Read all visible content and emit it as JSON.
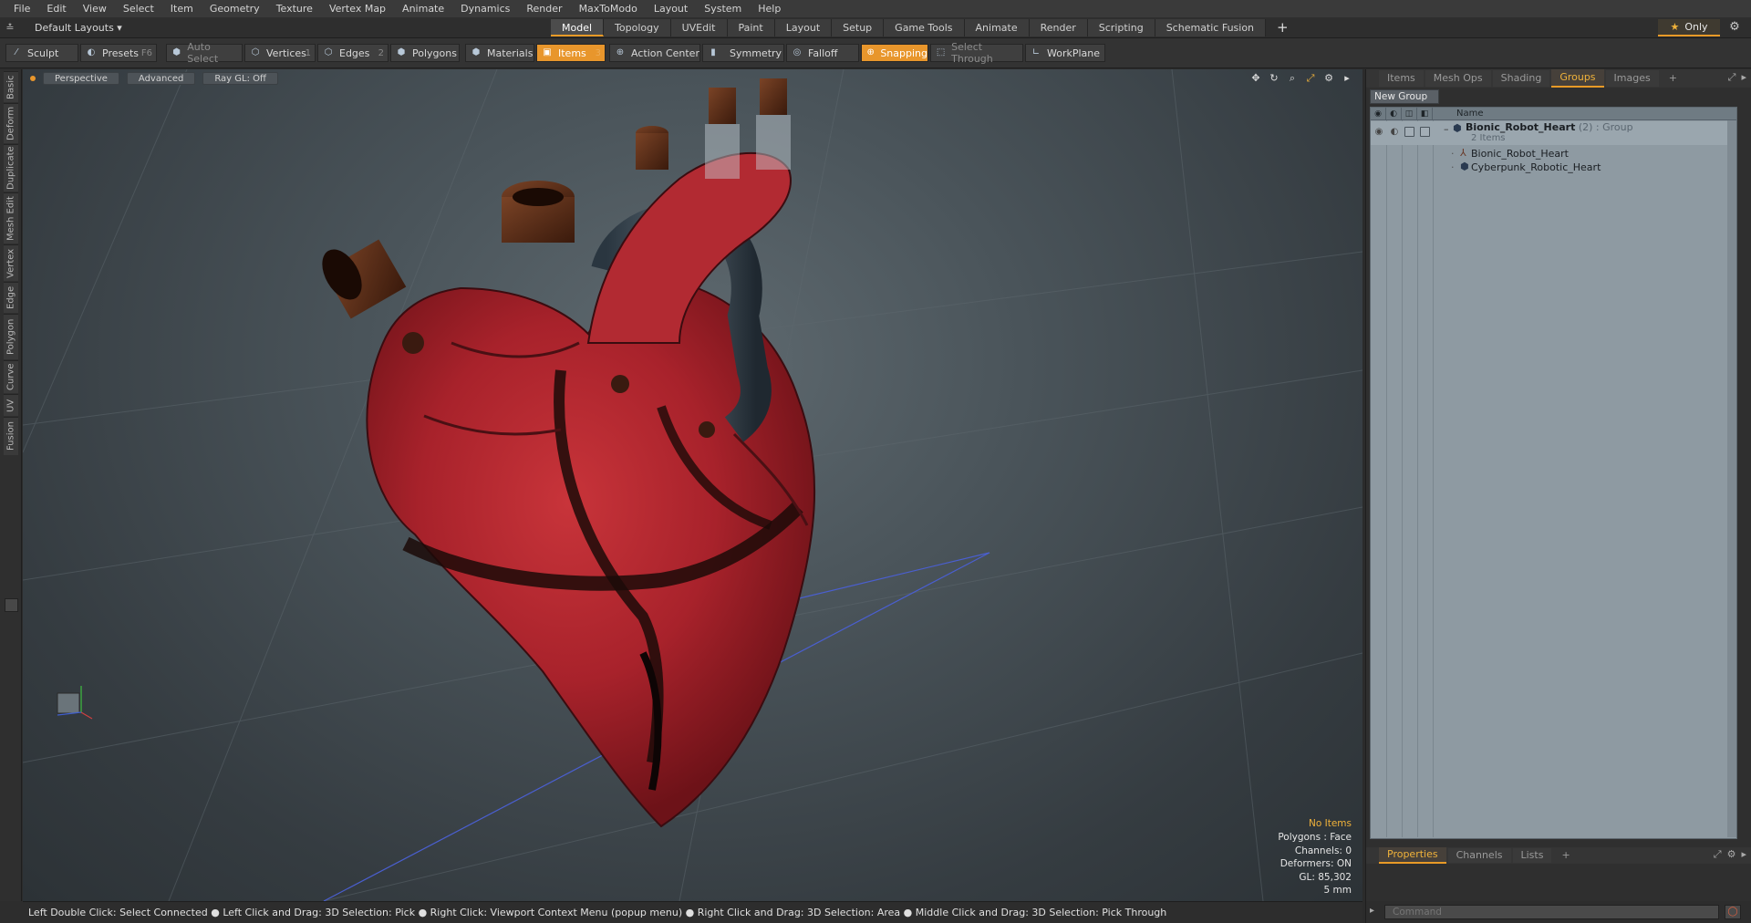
{
  "menu": [
    "File",
    "Edit",
    "View",
    "Select",
    "Item",
    "Geometry",
    "Texture",
    "Vertex Map",
    "Animate",
    "Dynamics",
    "Render",
    "MaxToModo",
    "Layout",
    "System",
    "Help"
  ],
  "layouts_dropdown": "Default Layouts ▾",
  "mode_tabs": [
    "Model",
    "Topology",
    "UVEdit",
    "Paint",
    "Layout",
    "Setup",
    "Game Tools",
    "Animate",
    "Render",
    "Scripting",
    "Schematic Fusion"
  ],
  "active_mode_tab": "Model",
  "only_label": "Only",
  "toolbar": {
    "sculpt": "Sculpt",
    "presets": "Presets",
    "presets_key": "F6",
    "auto_select": "Auto Select",
    "vertices": "Vertices",
    "vertices_count": "1",
    "edges": "Edges",
    "edges_count": "2",
    "polygons": "Polygons",
    "materials": "Materials",
    "items": "Items",
    "items_count": "3",
    "action_center": "Action Center",
    "symmetry": "Symmetry",
    "falloff": "Falloff",
    "snapping": "Snapping",
    "select_through": "Select Through",
    "workplane": "WorkPlane"
  },
  "left_tabs": [
    "Basic",
    "Deform",
    "Duplicate",
    "Mesh Edit",
    "Vertex",
    "Edge",
    "Polygon",
    "Curve",
    "UV",
    "Fusion"
  ],
  "viewport": {
    "view": "Perspective",
    "shading": "Advanced",
    "raygl": "Ray GL: Off",
    "stats": {
      "selection": "No Items",
      "polygons": "Polygons : Face",
      "channels": "Channels: 0",
      "deformers": "Deformers: ON",
      "gl": "GL: 85,302",
      "scale": "5 mm"
    }
  },
  "statusbar": "Left Double Click: Select Connected ● Left Click and Drag: 3D Selection: Pick ● Right Click: Viewport Context Menu (popup menu) ● Right Click and Drag: 3D Selection: Area ● Middle Click and Drag: 3D Selection: Pick Through",
  "right_panel": {
    "tabs": [
      "Items",
      "Mesh Ops",
      "Shading",
      "Groups",
      "Images"
    ],
    "active_tab": "Groups",
    "new_group": "New Group",
    "column_name": "Name",
    "groups": {
      "parent_name": "Bionic_Robot_Heart",
      "parent_suffix": "(2) : Group",
      "parent_count": "2 Items",
      "children": [
        "Bionic_Robot_Heart",
        "Cyberpunk_Robotic_Heart"
      ]
    },
    "bottom_tabs": [
      "Properties",
      "Channels",
      "Lists"
    ],
    "active_bottom_tab": "Properties",
    "command_placeholder": "Command"
  },
  "colors": {
    "accent": "#e8962c",
    "heart_red": "#b3262e",
    "heart_dark": "#3a1512",
    "tube_bronze": "#5a2e18"
  }
}
